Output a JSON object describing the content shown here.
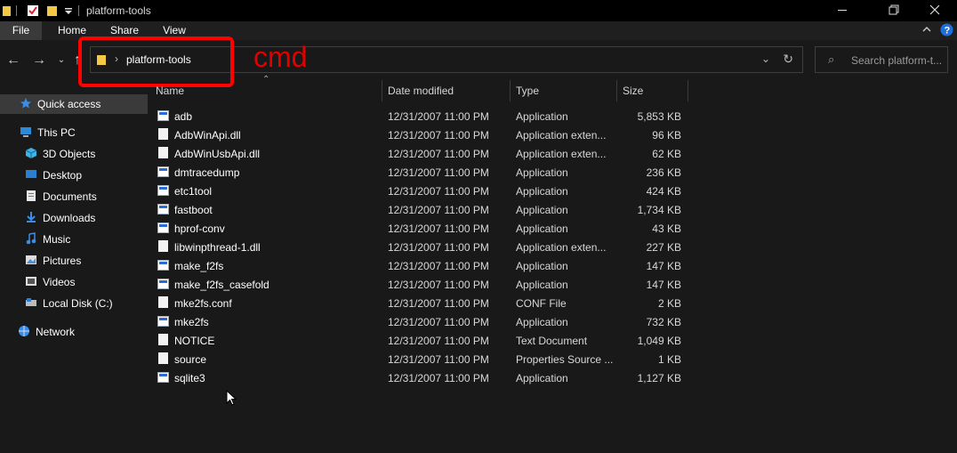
{
  "titlebar": {
    "title": "platform-tools",
    "minimize_icon": "minimize-icon",
    "maximize_icon": "maximize-icon",
    "close_icon": "close-icon"
  },
  "ribbon": {
    "tabs": [
      "File",
      "Home",
      "Share",
      "View"
    ]
  },
  "nav": {
    "breadcrumb": "platform-tools",
    "search_placeholder": "Search platform-t..."
  },
  "annotation": {
    "text": "cmd",
    "color": "#ff0000"
  },
  "sidebar": {
    "items": [
      {
        "label": "Quick access",
        "icon": "star-icon"
      },
      {
        "label": "This PC",
        "icon": "computer-icon"
      },
      {
        "label": "3D Objects",
        "icon": "cube-icon"
      },
      {
        "label": "Desktop",
        "icon": "desktop-icon"
      },
      {
        "label": "Documents",
        "icon": "documents-icon"
      },
      {
        "label": "Downloads",
        "icon": "download-icon"
      },
      {
        "label": "Music",
        "icon": "music-icon"
      },
      {
        "label": "Pictures",
        "icon": "pictures-icon"
      },
      {
        "label": "Videos",
        "icon": "videos-icon"
      },
      {
        "label": "Local Disk (C:)",
        "icon": "disk-icon"
      },
      {
        "label": "Network",
        "icon": "network-icon"
      }
    ]
  },
  "columns": {
    "name": "Name",
    "date": "Date modified",
    "type": "Type",
    "size": "Size"
  },
  "files": [
    {
      "name": "adb",
      "date": "12/31/2007 11:00 PM",
      "type": "Application",
      "size": "5,853 KB",
      "kind": "app"
    },
    {
      "name": "AdbWinApi.dll",
      "date": "12/31/2007 11:00 PM",
      "type": "Application exten...",
      "size": "96 KB",
      "kind": "doc"
    },
    {
      "name": "AdbWinUsbApi.dll",
      "date": "12/31/2007 11:00 PM",
      "type": "Application exten...",
      "size": "62 KB",
      "kind": "doc"
    },
    {
      "name": "dmtracedump",
      "date": "12/31/2007 11:00 PM",
      "type": "Application",
      "size": "236 KB",
      "kind": "app"
    },
    {
      "name": "etc1tool",
      "date": "12/31/2007 11:00 PM",
      "type": "Application",
      "size": "424 KB",
      "kind": "app"
    },
    {
      "name": "fastboot",
      "date": "12/31/2007 11:00 PM",
      "type": "Application",
      "size": "1,734 KB",
      "kind": "app"
    },
    {
      "name": "hprof-conv",
      "date": "12/31/2007 11:00 PM",
      "type": "Application",
      "size": "43 KB",
      "kind": "app"
    },
    {
      "name": "libwinpthread-1.dll",
      "date": "12/31/2007 11:00 PM",
      "type": "Application exten...",
      "size": "227 KB",
      "kind": "doc"
    },
    {
      "name": "make_f2fs",
      "date": "12/31/2007 11:00 PM",
      "type": "Application",
      "size": "147 KB",
      "kind": "app"
    },
    {
      "name": "make_f2fs_casefold",
      "date": "12/31/2007 11:00 PM",
      "type": "Application",
      "size": "147 KB",
      "kind": "app"
    },
    {
      "name": "mke2fs.conf",
      "date": "12/31/2007 11:00 PM",
      "type": "CONF File",
      "size": "2 KB",
      "kind": "doc"
    },
    {
      "name": "mke2fs",
      "date": "12/31/2007 11:00 PM",
      "type": "Application",
      "size": "732 KB",
      "kind": "app"
    },
    {
      "name": "NOTICE",
      "date": "12/31/2007 11:00 PM",
      "type": "Text Document",
      "size": "1,049 KB",
      "kind": "doc"
    },
    {
      "name": "source",
      "date": "12/31/2007 11:00 PM",
      "type": "Properties Source ...",
      "size": "1 KB",
      "kind": "doc"
    },
    {
      "name": "sqlite3",
      "date": "12/31/2007 11:00 PM",
      "type": "Application",
      "size": "1,127 KB",
      "kind": "app"
    }
  ]
}
